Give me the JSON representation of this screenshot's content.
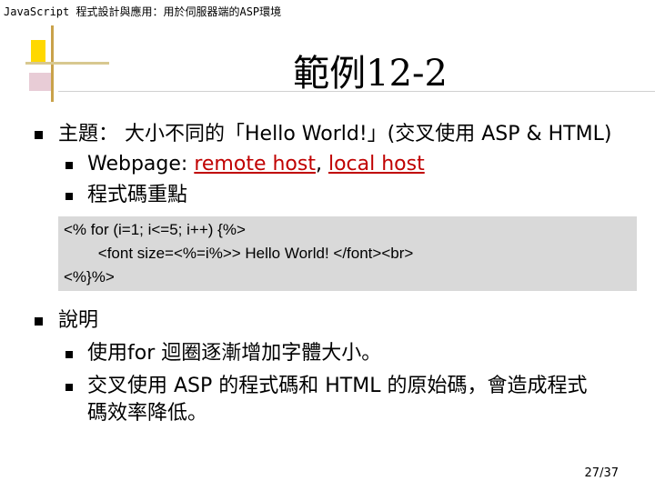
{
  "header": {
    "text": "JavaScript 程式設計與應用：用於伺服器端的ASP環境"
  },
  "title": "範例12-2",
  "bullets": {
    "topic": {
      "label": "主題：",
      "text": "大小不同的「Hello World!」(交叉使用 ASP & HTML)"
    },
    "webpage": {
      "prefix": "Webpage: ",
      "link1": "remote host",
      "sep": ", ",
      "link2": "local host"
    },
    "keypoints": "程式碼重點",
    "explain_label": "說明",
    "explain_1": "使用for 迴圈逐漸增加字體大小。",
    "explain_2a": "交叉使用 ASP 的程式碼和 HTML 的原始碼，會造成程式",
    "explain_2b": "碼效率降低。"
  },
  "code": {
    "line1": "<% for (i=1; i<=5; i++) {%>",
    "line2": "        <font size=<%=i%>> Hello World! </font><br>",
    "line3": "<%}%>"
  },
  "page_number": "27/37",
  "colors": {
    "link": "#c00000",
    "code_bg": "#d9d9d9",
    "accent_yellow": "#ffd800",
    "accent_pink": "#e8ccd6"
  }
}
